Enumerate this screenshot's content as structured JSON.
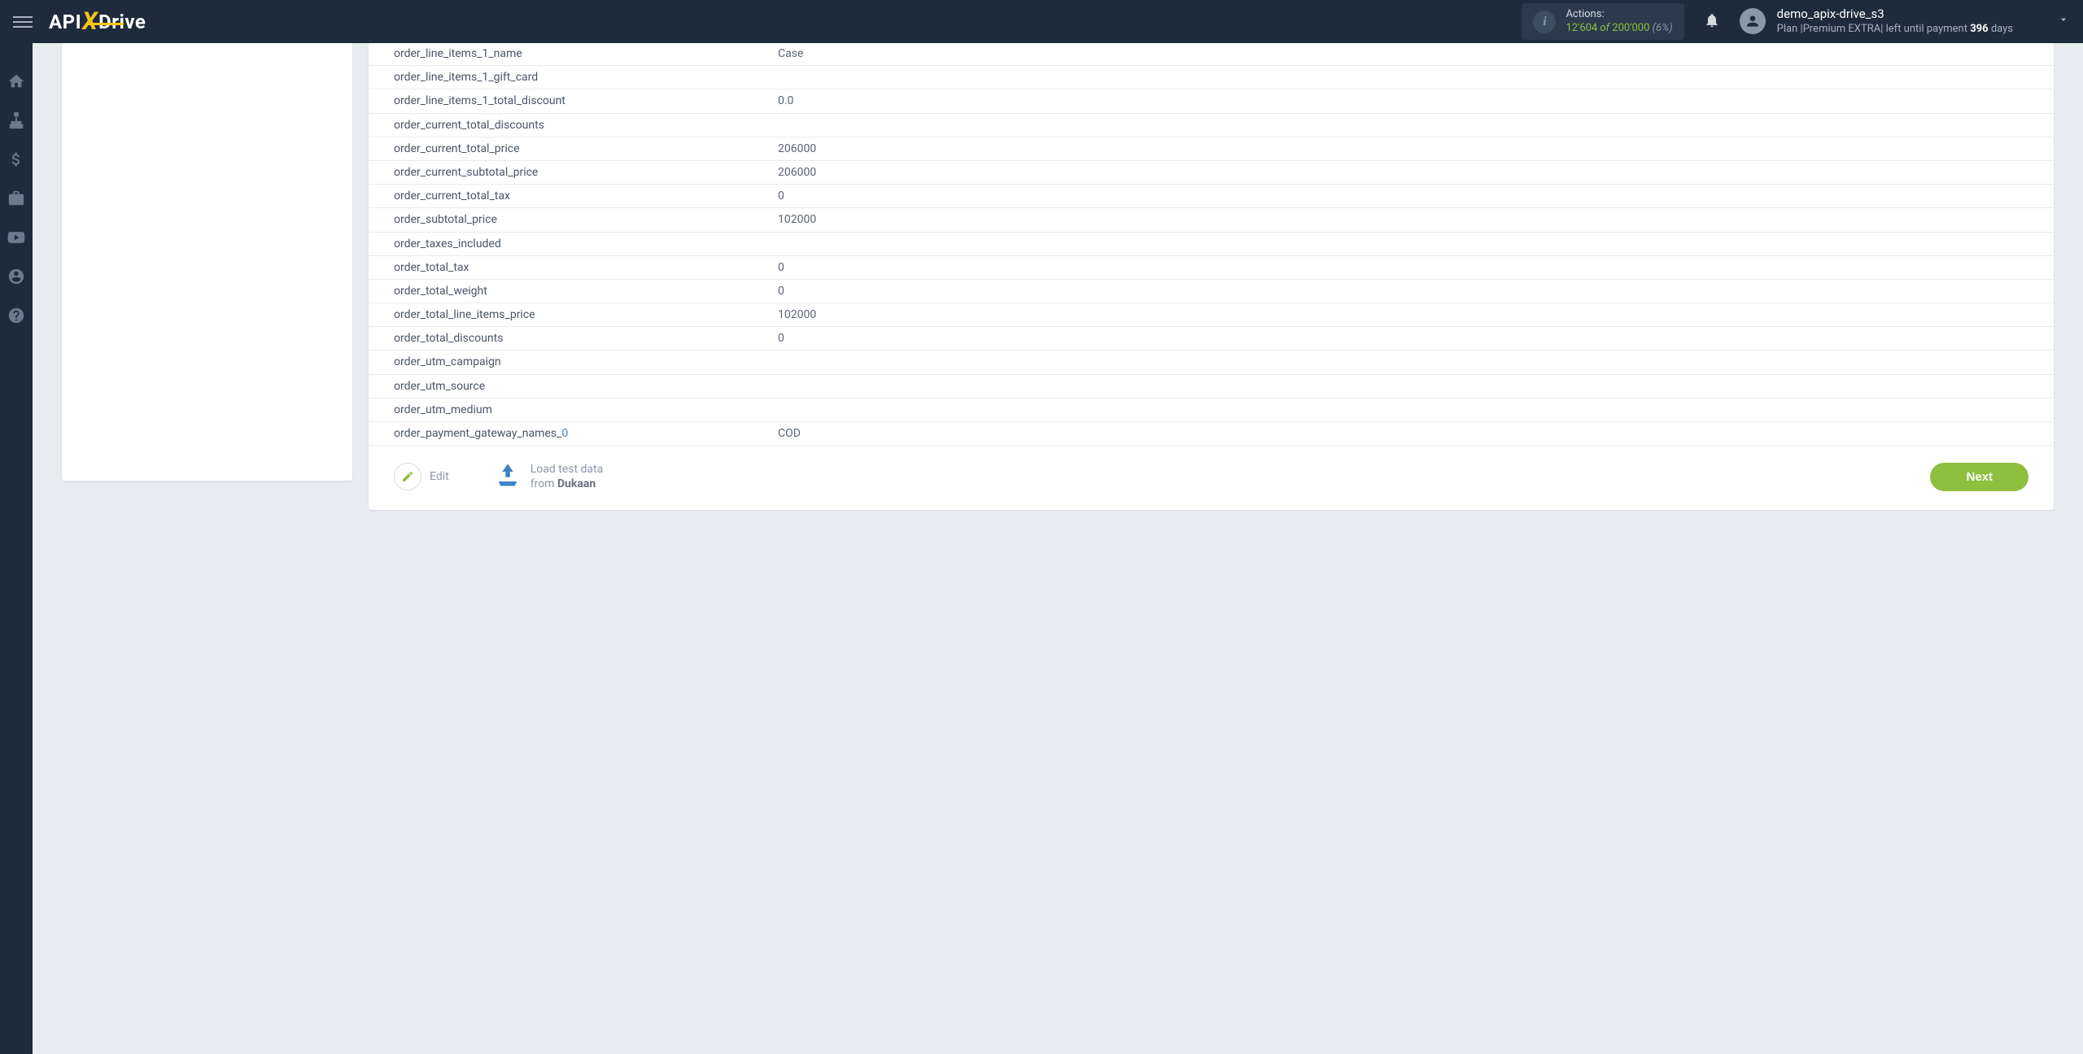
{
  "header": {
    "logo": {
      "api": "API",
      "x": "X",
      "drive": "Drive"
    },
    "actions": {
      "label": "Actions:",
      "used": "12'604",
      "of": "of",
      "total": "200'000",
      "pct": "(6%)"
    },
    "user": {
      "name": "demo_apix-drive_s3",
      "plan_prefix": "Plan |",
      "plan_name": "Premium EXTRA",
      "plan_mid": "| left until payment ",
      "plan_days": "396",
      "plan_suffix": " days"
    }
  },
  "table": {
    "rows": [
      {
        "key": "order_line_items_1_name",
        "suffix": "",
        "val": "Case"
      },
      {
        "key": "order_line_items_1_gift_card",
        "suffix": "",
        "val": ""
      },
      {
        "key": "order_line_items_1_total_discount",
        "suffix": "",
        "val": "0.0"
      },
      {
        "key": "order_current_total_discounts",
        "suffix": "",
        "val": ""
      },
      {
        "key": "order_current_total_price",
        "suffix": "",
        "val": "206000"
      },
      {
        "key": "order_current_subtotal_price",
        "suffix": "",
        "val": "206000"
      },
      {
        "key": "order_current_total_tax",
        "suffix": "",
        "val": "0"
      },
      {
        "key": "order_subtotal_price",
        "suffix": "",
        "val": "102000"
      },
      {
        "key": "order_taxes_included",
        "suffix": "",
        "val": ""
      },
      {
        "key": "order_total_tax",
        "suffix": "",
        "val": "0"
      },
      {
        "key": "order_total_weight",
        "suffix": "",
        "val": "0"
      },
      {
        "key": "order_total_line_items_price",
        "suffix": "",
        "val": "102000"
      },
      {
        "key": "order_total_discounts",
        "suffix": "",
        "val": "0"
      },
      {
        "key": "order_utm_campaign",
        "suffix": "",
        "val": ""
      },
      {
        "key": "order_utm_source",
        "suffix": "",
        "val": ""
      },
      {
        "key": "order_utm_medium",
        "suffix": "",
        "val": ""
      },
      {
        "key": "order_payment_gateway_names_",
        "suffix": "0",
        "val": "COD"
      }
    ]
  },
  "footer": {
    "edit": "Edit",
    "load_line1": "Load test data",
    "load_from": "from ",
    "load_source": "Dukaan",
    "next": "Next"
  }
}
